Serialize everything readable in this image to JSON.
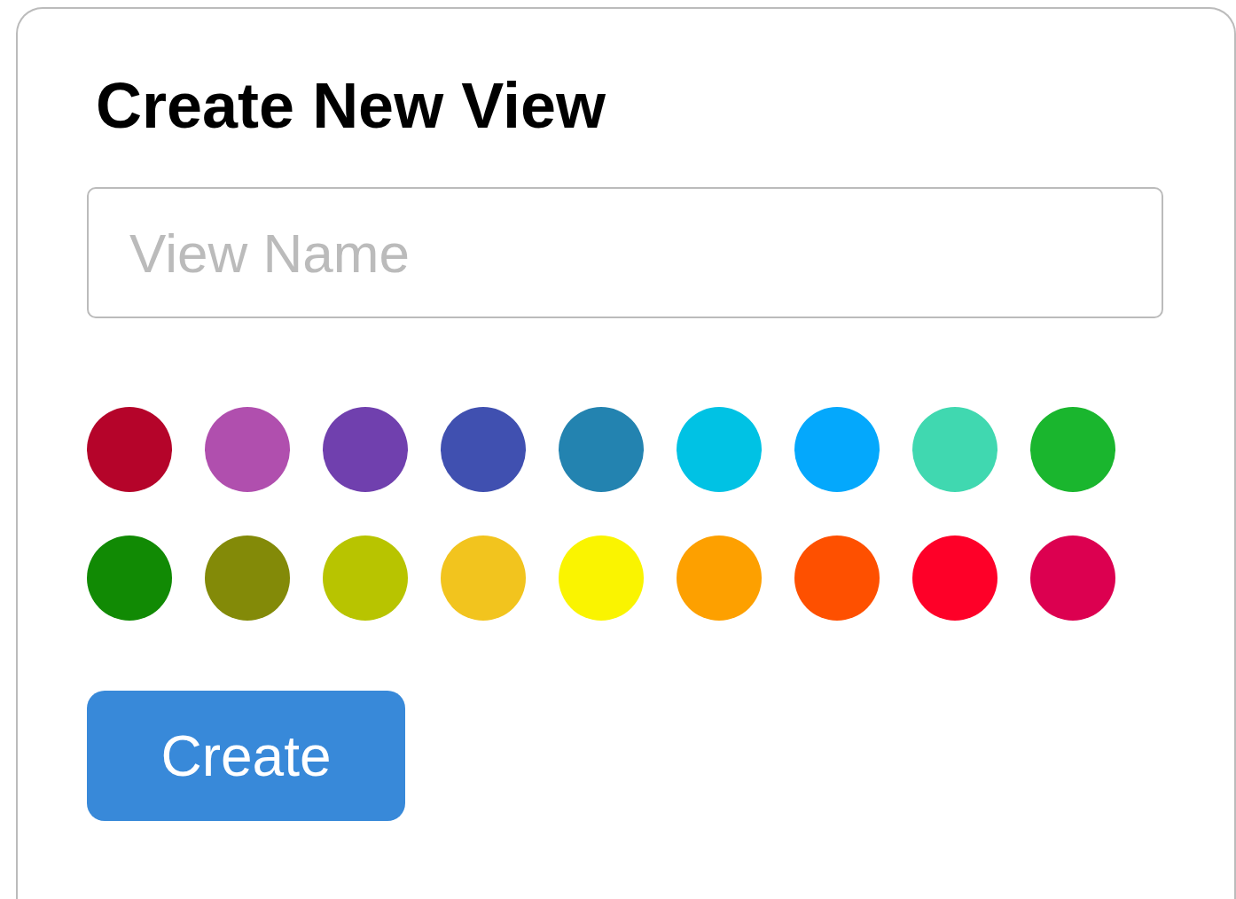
{
  "title": "Create New View",
  "name_field": {
    "placeholder": "View Name"
  },
  "swatches": [
    {
      "color": "#b5042a"
    },
    {
      "color": "#b04fae"
    },
    {
      "color": "#7040ae"
    },
    {
      "color": "#4050b0"
    },
    {
      "color": "#2383b0"
    },
    {
      "color": "#00c2e4"
    },
    {
      "color": "#04a8fc"
    },
    {
      "color": "#40d8b0"
    },
    {
      "color": "#1ab62e"
    },
    {
      "color": "#118a04"
    },
    {
      "color": "#838a08"
    },
    {
      "color": "#b8c400"
    },
    {
      "color": "#f2c41e"
    },
    {
      "color": "#faf400"
    },
    {
      "color": "#fda000"
    },
    {
      "color": "#fe5000"
    },
    {
      "color": "#fe0028"
    },
    {
      "color": "#dc0050"
    }
  ],
  "button": "Create"
}
